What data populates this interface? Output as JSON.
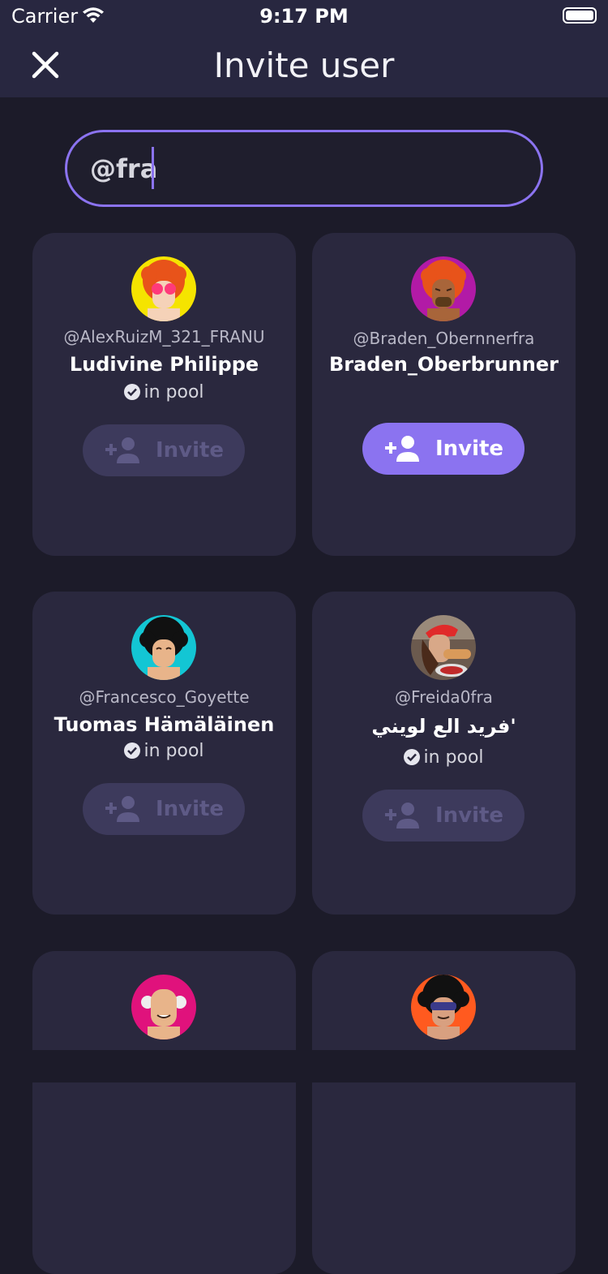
{
  "status_bar": {
    "carrier": "Carrier",
    "time": "9:17 PM"
  },
  "header": {
    "title": "Invite user",
    "close_icon": "close-icon"
  },
  "search": {
    "value": "@fra",
    "placeholder": ""
  },
  "colors": {
    "accent": "#8b73f0",
    "card": "#2a283e",
    "background": "#1c1b29",
    "header": "#282740"
  },
  "users": [
    {
      "handle": "@AlexRuizM_321_FRANU",
      "name": "Ludivine Philippe",
      "in_pool": true,
      "status": "in pool",
      "invite_label": "Invite",
      "invite_enabled": false,
      "avatar_bg": "#f5e400"
    },
    {
      "handle": "@Braden_Obernnerfra",
      "name": "Braden_Oberbrunner",
      "in_pool": false,
      "status": "",
      "invite_label": "Invite",
      "invite_enabled": true,
      "avatar_bg": "#b21aa6"
    },
    {
      "handle": "@Francesco_Goyette",
      "name": "Tuomas Hämäläinen",
      "in_pool": true,
      "status": "in pool",
      "invite_label": "Invite",
      "invite_enabled": false,
      "avatar_bg": "#13c6d4"
    },
    {
      "handle": "@Freida0fra",
      "name": "فريد الع لويني'",
      "in_pool": true,
      "status": "in pool",
      "invite_label": "Invite",
      "invite_enabled": false,
      "avatar_bg": "#6b5a4e"
    },
    {
      "handle": "",
      "name": "",
      "in_pool": false,
      "status": "",
      "invite_label": "",
      "invite_enabled": false,
      "avatar_bg": "#e0127c"
    },
    {
      "handle": "",
      "name": "",
      "in_pool": false,
      "status": "",
      "invite_label": "",
      "invite_enabled": false,
      "avatar_bg": "#ff5a1f"
    }
  ]
}
